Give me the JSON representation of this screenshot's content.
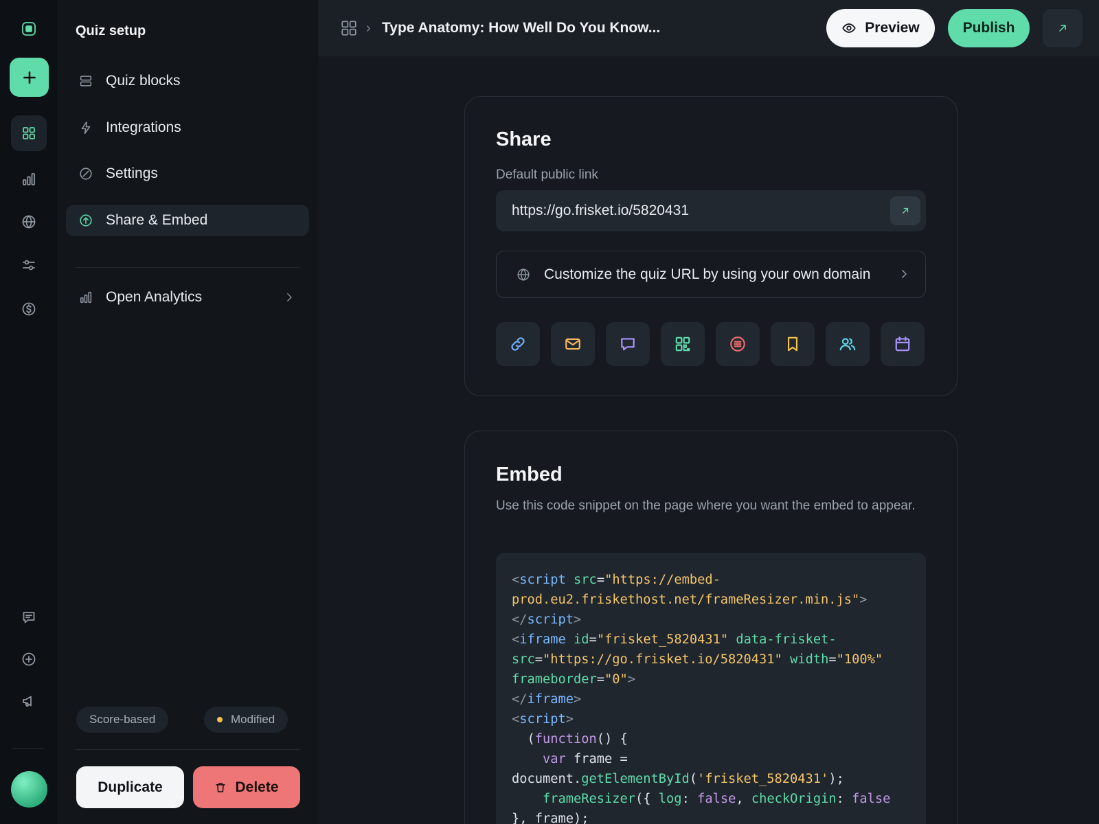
{
  "panel": {
    "title": "Quiz setup",
    "nav": [
      {
        "label": "Quiz blocks"
      },
      {
        "label": "Integrations"
      },
      {
        "label": "Settings"
      },
      {
        "label": "Share & Embed"
      }
    ],
    "analytics_label": "Open Analytics",
    "badges": {
      "type": "Score-based",
      "status": "Modified"
    },
    "duplicate_label": "Duplicate",
    "delete_label": "Delete"
  },
  "header": {
    "title": "Type Anatomy: How Well Do You Know...",
    "separator": "›",
    "preview_label": "Preview",
    "publish_label": "Publish"
  },
  "share": {
    "title": "Share",
    "link_label": "Default public link",
    "link_value": "https://go.frisket.io/5820431",
    "domain_cta": "Customize the quiz URL by using your own domain",
    "channels": [
      {
        "icon": "link-icon",
        "color": "#6fb3ff"
      },
      {
        "icon": "mail-icon",
        "color": "#f4b860"
      },
      {
        "icon": "chat-icon",
        "color": "#a995ff"
      },
      {
        "icon": "qr-code-icon",
        "color": "#5fdcaa"
      },
      {
        "icon": "list-circle-icon",
        "color": "#ef6b6b"
      },
      {
        "icon": "bookmark-icon",
        "color": "#f4c14e"
      },
      {
        "icon": "users-icon",
        "color": "#5fd4e8"
      },
      {
        "icon": "calendar-icon",
        "color": "#a995ff"
      }
    ]
  },
  "embed": {
    "title": "Embed",
    "description": "Use this code snippet on the page where you want the embed to appear.",
    "code": {
      "script_open": "script",
      "src_attr": "src",
      "src_value_1": "\"https://embed-",
      "src_value_2": "prod.eu2.friskethost.net/frameResizer.min.js\"",
      "iframe_tag": "iframe",
      "id_attr": "id",
      "id_value": "\"frisket_5820431\"",
      "data_attr_1": "data-frisket-",
      "data_attr_2": "src",
      "data_value": "\"https://go.frisket.io/5820431\"",
      "width_attr": "width",
      "width_value": "\"100%\"",
      "fb_attr": "frameborder",
      "fb_value": "\"0\"",
      "function_kw": "function",
      "var_kw": "var",
      "frame_var": "frame =",
      "doc": "document.",
      "get_fn": "getElementById",
      "get_arg": "'frisket_5820431'",
      "resizer_fn": "frameResizer",
      "log_key": "log",
      "false_1": "false",
      "check_key": "checkOrigin",
      "false_2": "false",
      "close": "}, frame);"
    }
  },
  "colors": {
    "accent": "#5fdcaa",
    "danger": "#ef7676",
    "modified_dot": "#f2c14e"
  }
}
